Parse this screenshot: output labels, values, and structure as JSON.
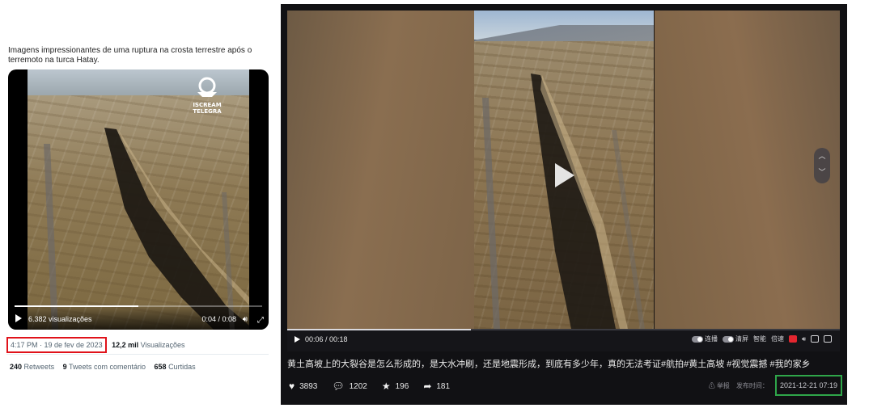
{
  "tweet": {
    "text": "Imagens impressionantes de uma ruptura na crosta terrestre após o terremoto na turca Hatay.",
    "video": {
      "views_label": "6.382 visualizações",
      "time": "0:04 / 0:08",
      "progress_fraction": 0.5,
      "watermark": "ISCREAM TELEGRAM"
    },
    "timestamp": "4:17 PM · 19 de fev de 2023",
    "views_count": "12,2 mil",
    "views_word": "Visualizações",
    "stats": {
      "retweets_num": "240",
      "retweets_label": "Retweets",
      "comments_num": "9",
      "comments_label": "Tweets com comentário",
      "likes_num": "658",
      "likes_label": "Curtidas"
    },
    "highlight_color": "#e0121a"
  },
  "player": {
    "time": "00:06 / 00:18",
    "progress_fraction": 0.333,
    "tools": {
      "continuous": "连播",
      "clear": "清屏",
      "smart": "智能",
      "speed": "倍速"
    },
    "description": "黄土高坡上的大裂谷是怎么形成的，是大水冲刷，还是地震形成，到底有多少年，真的无法考证#航拍#黄土高坡 #视觉震撼 #我的家乡",
    "likes": "3893",
    "comments": "1202",
    "favorites": "196",
    "shares": "181",
    "report": "举报",
    "publish_label": "发布时间：",
    "publish_date": "2021-12-21 07:19",
    "highlight_color": "#2fa64a"
  }
}
